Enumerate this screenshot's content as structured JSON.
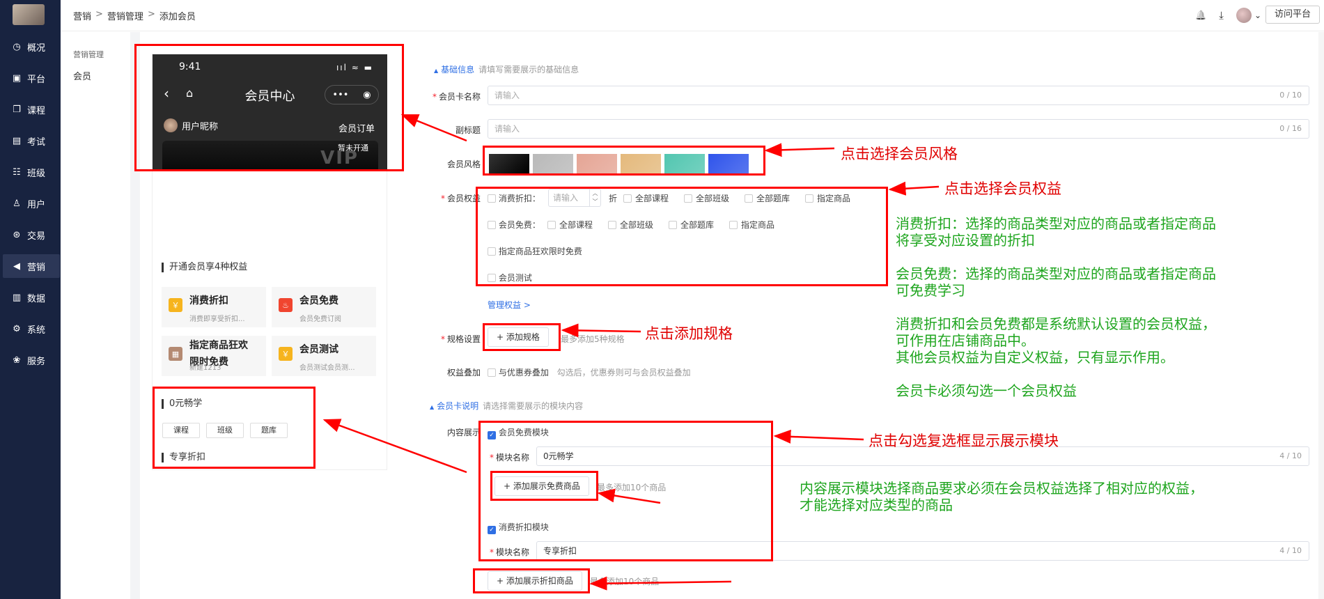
{
  "sidebar": {
    "items": [
      {
        "label": "概况",
        "icon": "clock-icon",
        "glyph": "◷"
      },
      {
        "label": "平台",
        "icon": "monitor-icon",
        "glyph": "▣"
      },
      {
        "label": "课程",
        "icon": "book-icon",
        "glyph": "❐"
      },
      {
        "label": "考试",
        "icon": "exam-icon",
        "glyph": "▤"
      },
      {
        "label": "班级",
        "icon": "group-icon",
        "glyph": "☷"
      },
      {
        "label": "用户",
        "icon": "user-icon",
        "glyph": "♙"
      },
      {
        "label": "交易",
        "icon": "trade-icon",
        "glyph": "⊛"
      },
      {
        "label": "营销",
        "icon": "megaphone-icon",
        "glyph": "◀"
      },
      {
        "label": "数据",
        "icon": "bar-chart-icon",
        "glyph": "▥"
      },
      {
        "label": "系统",
        "icon": "gear-icon",
        "glyph": "⚙"
      },
      {
        "label": "服务",
        "icon": "service-icon",
        "glyph": "❀"
      }
    ],
    "active_index": 7
  },
  "breadcrumb": {
    "items": [
      "营销",
      "营销管理",
      "添加会员"
    ],
    "separator": ">"
  },
  "header": {
    "visit_button": "访问平台",
    "bell_glyph": "🔔",
    "download_glyph": "⤓",
    "caret": "⌄"
  },
  "submenu": {
    "title": "营销管理",
    "item": "会员"
  },
  "preview": {
    "time": "9:41",
    "status": "ııl ≈ ▬",
    "title": "会员中心",
    "back": "‹",
    "home": "⌂",
    "more": "•••",
    "record": "◉",
    "username": "用户昵称",
    "order": "会员订单",
    "not_open": "暂未开通",
    "vip": "VIP",
    "benefits_title": "开通会员享4种权益",
    "benefits": [
      {
        "title": "消费折扣",
        "sub": "消费即享受折扣...",
        "color": "#f6b41e",
        "glyph": "￥"
      },
      {
        "title": "会员免费",
        "sub": "会员免费订阅",
        "color": "#f0452f",
        "glyph": "♨"
      },
      {
        "title": "指定商品狂欢限时免费",
        "sub": "新建1213",
        "color": "#b48a72",
        "glyph": "▦"
      },
      {
        "title": "会员测试",
        "sub": "会员测试会员测...",
        "color": "#f6b41e",
        "glyph": "￥"
      }
    ],
    "module1_title": "0元畅学",
    "chips": [
      "课程",
      "班级",
      "题库"
    ],
    "module2_title": "专享折扣"
  },
  "form": {
    "basic_section": "基础信息",
    "basic_hint": "请填写需要展示的基础信息",
    "name_label": "会员卡名称",
    "name_placeholder": "请输入",
    "name_count": "0 / 10",
    "subtitle_label": "副标题",
    "subtitle_placeholder": "请输入",
    "subtitle_count": "0 / 16",
    "style_label": "会员风格",
    "styles": [
      "#111111",
      "#b9b9b9",
      "#e5a595",
      "#e4b97c",
      "#52c6b0",
      "#2f54eb"
    ],
    "rights_label": "会员权益",
    "discount_label": "消费折扣：",
    "discount_placeholder": "请输入",
    "discount_unit": "折",
    "discount_items": [
      "全部课程",
      "全部班级",
      "全部题库",
      "指定商品"
    ],
    "free_label": "会员免费：",
    "free_items": [
      "全部课程",
      "全部班级",
      "全部题库",
      "指定商品"
    ],
    "right3": "指定商品狂欢限时免费",
    "right4": "会员测试",
    "manage_link": "管理权益 >",
    "spec_label": "规格设置",
    "spec_button": "+ 添加规格",
    "spec_hint": "最多添加5种规格",
    "stack_label": "权益叠加",
    "stack_option": "与优惠券叠加",
    "stack_hint": "勾选后，优惠券则可与会员权益叠加",
    "desc_section": "会员卡说明",
    "desc_hint": "请选择需要展示的模块内容",
    "content_label": "内容展示",
    "module_free": "会员免费模块",
    "module_name_label": "模块名称",
    "module_free_value": "0元畅学",
    "module_free_count": "4 / 10",
    "add_free_button": "+ 添加展示免费商品",
    "add_free_hint": "最多添加10个商品",
    "module_discount": "消费折扣模块",
    "module_discount_value": "专享折扣",
    "module_discount_count": "4 / 10",
    "add_discount_button": "+ 添加展示折扣商品",
    "add_discount_hint": "最多添加10个商品"
  },
  "annotations": {
    "style": "点击选择会员风格",
    "rights": "点击选择会员权益",
    "spec": "点击添加规格",
    "module": "点击勾选复选框显示展示模块",
    "green1": "消费折扣：选择的商品类型对应的商品或者指定商品\n将享受对应设置的折扣",
    "green2": "会员免费：选择的商品类型对应的商品或者指定商品\n可免费学习",
    "green3": "消费折扣和会员免费都是系统默认设置的会员权益，\n可作用在店铺商品中。\n其他会员权益为自定义权益，只有显示作用。",
    "green4": "会员卡必须勾选一个会员权益",
    "green5": "内容展示模块选择商品要求必须在会员权益选择了相对应的权益，\n才能选择对应类型的商品",
    "red": "#e00000",
    "green": "#1ea51e"
  }
}
